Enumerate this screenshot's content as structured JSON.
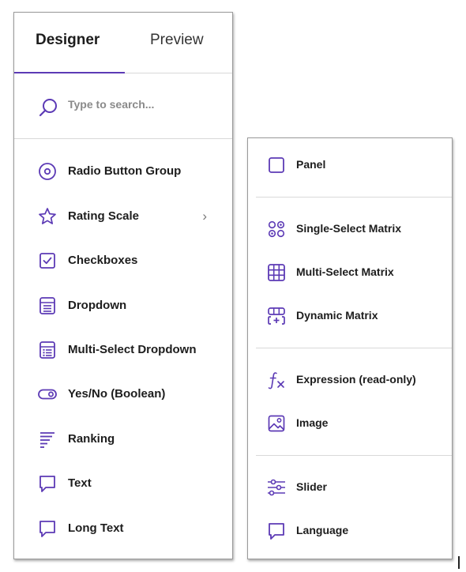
{
  "tabs": {
    "designer": "Designer",
    "preview": "Preview"
  },
  "search": {
    "placeholder": "Type to search..."
  },
  "left_items": [
    {
      "label": "Radio Button Group",
      "icon": "radio-button-icon"
    },
    {
      "label": "Rating Scale",
      "icon": "star-icon",
      "has_submenu": true
    },
    {
      "label": "Checkboxes",
      "icon": "checkbox-icon"
    },
    {
      "label": "Dropdown",
      "icon": "dropdown-icon"
    },
    {
      "label": "Multi-Select Dropdown",
      "icon": "multi-select-dropdown-icon"
    },
    {
      "label": "Yes/No (Boolean)",
      "icon": "toggle-icon"
    },
    {
      "label": "Ranking",
      "icon": "ranking-icon"
    },
    {
      "label": "Text",
      "icon": "speech-bubble-icon"
    },
    {
      "label": "Long Text",
      "icon": "speech-bubble-icon"
    }
  ],
  "submenu": {
    "chevron": "›"
  },
  "right_items": [
    {
      "label": "Panel",
      "icon": "panel-icon"
    },
    {
      "label": "Single-Select Matrix",
      "icon": "single-select-matrix-icon"
    },
    {
      "label": "Multi-Select Matrix",
      "icon": "grid-icon"
    },
    {
      "label": "Dynamic Matrix",
      "icon": "dynamic-matrix-icon"
    },
    {
      "label": "Expression (read-only)",
      "icon": "function-icon"
    },
    {
      "label": "Image",
      "icon": "image-icon"
    },
    {
      "label": "Slider",
      "icon": "slider-icon"
    },
    {
      "label": "Language",
      "icon": "speech-bubble-icon"
    }
  ],
  "colors": {
    "accent": "#5c3ab5",
    "text": "#1d1d1d",
    "placeholder": "#8a8a8a",
    "border": "#d9d9d9"
  }
}
